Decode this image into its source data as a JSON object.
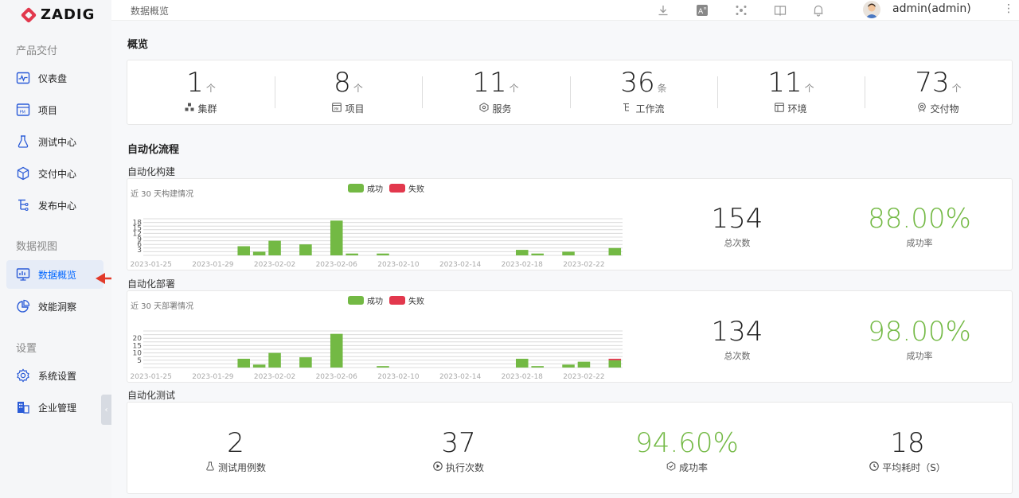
{
  "app": {
    "logo_text": "ZADIG"
  },
  "sidebar": {
    "sections": [
      {
        "title": "产品交付"
      },
      {
        "title": "数据视图"
      },
      {
        "title": "设置"
      }
    ],
    "items": [
      {
        "label": "仪表盘",
        "icon": "dashboard-icon"
      },
      {
        "label": "项目",
        "icon": "project-icon"
      },
      {
        "label": "测试中心",
        "icon": "flask-icon"
      },
      {
        "label": "交付中心",
        "icon": "box-icon"
      },
      {
        "label": "发布中心",
        "icon": "release-icon"
      },
      {
        "label": "数据概览",
        "icon": "monitor-chart-icon",
        "active": true
      },
      {
        "label": "效能洞察",
        "icon": "pie-chart-icon"
      },
      {
        "label": "系统设置",
        "icon": "gear-icon"
      },
      {
        "label": "企业管理",
        "icon": "enterprise-icon"
      }
    ],
    "collapse_glyph": "‹"
  },
  "topbar": {
    "breadcrumb": "数据概览",
    "username": "admin(admin)",
    "more": "⋮"
  },
  "overview": {
    "title": "概览",
    "stats": [
      {
        "value": "1",
        "unit": "个",
        "label": "集群",
        "icon": "cluster-icon"
      },
      {
        "value": "8",
        "unit": "个",
        "label": "项目",
        "icon": "project-icon"
      },
      {
        "value": "11",
        "unit": "个",
        "label": "服务",
        "icon": "service-icon"
      },
      {
        "value": "36",
        "unit": "条",
        "label": "工作流",
        "icon": "workflow-icon"
      },
      {
        "value": "11",
        "unit": "个",
        "label": "环境",
        "icon": "environment-icon"
      },
      {
        "value": "73",
        "unit": "个",
        "label": "交付物",
        "icon": "artifact-icon"
      }
    ]
  },
  "automation": {
    "title": "自动化流程",
    "build": {
      "title": "自动化构建",
      "subtitle": "近 30 天构建情况",
      "total_value": "154",
      "total_label": "总次数",
      "rate_value": "88.00%",
      "rate_label": "成功率"
    },
    "deploy": {
      "title": "自动化部署",
      "subtitle": "近 30 天部署情况",
      "total_value": "134",
      "total_label": "总次数",
      "rate_value": "98.00%",
      "rate_label": "成功率"
    },
    "test": {
      "title": "自动化测试",
      "stats": [
        {
          "value": "2",
          "label": "测试用例数",
          "icon": "flask-icon"
        },
        {
          "value": "37",
          "label": "执行次数",
          "icon": "play-circle-icon"
        },
        {
          "value": "94.60%",
          "label": "成功率",
          "icon": "shield-check-icon",
          "green": true
        },
        {
          "value": "18",
          "label": "平均耗时（S）",
          "icon": "clock-icon"
        }
      ]
    }
  },
  "colors": {
    "success": "#73b944",
    "fail": "#e2384d",
    "accent": "#0066ff"
  },
  "chart_data": [
    {
      "type": "bar",
      "x_ticks": [
        "2023-01-25",
        "2023-01-29",
        "2023-02-02",
        "2023-02-06",
        "2023-02-10",
        "2023-02-14",
        "2023-02-18",
        "2023-02-22"
      ],
      "y_ticks": [
        "3",
        "6",
        "9",
        "12",
        "15",
        "18"
      ],
      "ylim": [
        0,
        20
      ],
      "legend": "top-center",
      "series": [
        {
          "name": "成功",
          "color": "#73b944",
          "values": [
            0,
            0,
            0,
            0,
            0,
            0,
            5,
            2,
            8,
            0,
            6,
            0,
            19,
            1,
            0,
            1,
            0,
            0,
            0,
            0,
            0,
            0,
            0,
            0,
            3,
            1,
            0,
            2,
            0,
            0,
            4
          ]
        },
        {
          "name": "失败",
          "color": "#e2384d",
          "values": [
            0,
            0,
            0,
            0,
            0,
            0,
            0,
            0,
            0,
            0,
            0,
            0,
            0,
            0,
            0,
            0,
            0,
            0,
            0,
            0,
            0,
            0,
            0,
            0,
            0,
            0,
            0,
            0,
            0,
            0,
            0
          ]
        }
      ]
    },
    {
      "type": "bar",
      "x_ticks": [
        "2023-01-25",
        "2023-01-29",
        "2023-02-02",
        "2023-02-06",
        "2023-02-10",
        "2023-02-14",
        "2023-02-18",
        "2023-02-22"
      ],
      "y_ticks": [
        "5",
        "10",
        "15",
        "20"
      ],
      "ylim": [
        0,
        25
      ],
      "legend": "top-center",
      "series": [
        {
          "name": "成功",
          "color": "#73b944",
          "values": [
            0,
            0,
            0,
            0,
            0,
            0,
            6,
            2,
            10,
            0,
            7,
            0,
            23,
            0,
            0,
            1,
            0,
            0,
            0,
            0,
            0,
            0,
            0,
            0,
            6,
            1,
            0,
            2,
            4,
            0,
            5
          ]
        },
        {
          "name": "失败",
          "color": "#e2384d",
          "values": [
            0,
            0,
            0,
            0,
            0,
            0,
            0,
            0,
            0,
            0,
            0,
            0,
            0,
            0,
            0,
            0,
            0,
            0,
            0,
            0,
            0,
            0,
            0,
            0,
            0,
            0,
            0,
            0,
            0,
            0,
            1
          ]
        }
      ]
    }
  ]
}
